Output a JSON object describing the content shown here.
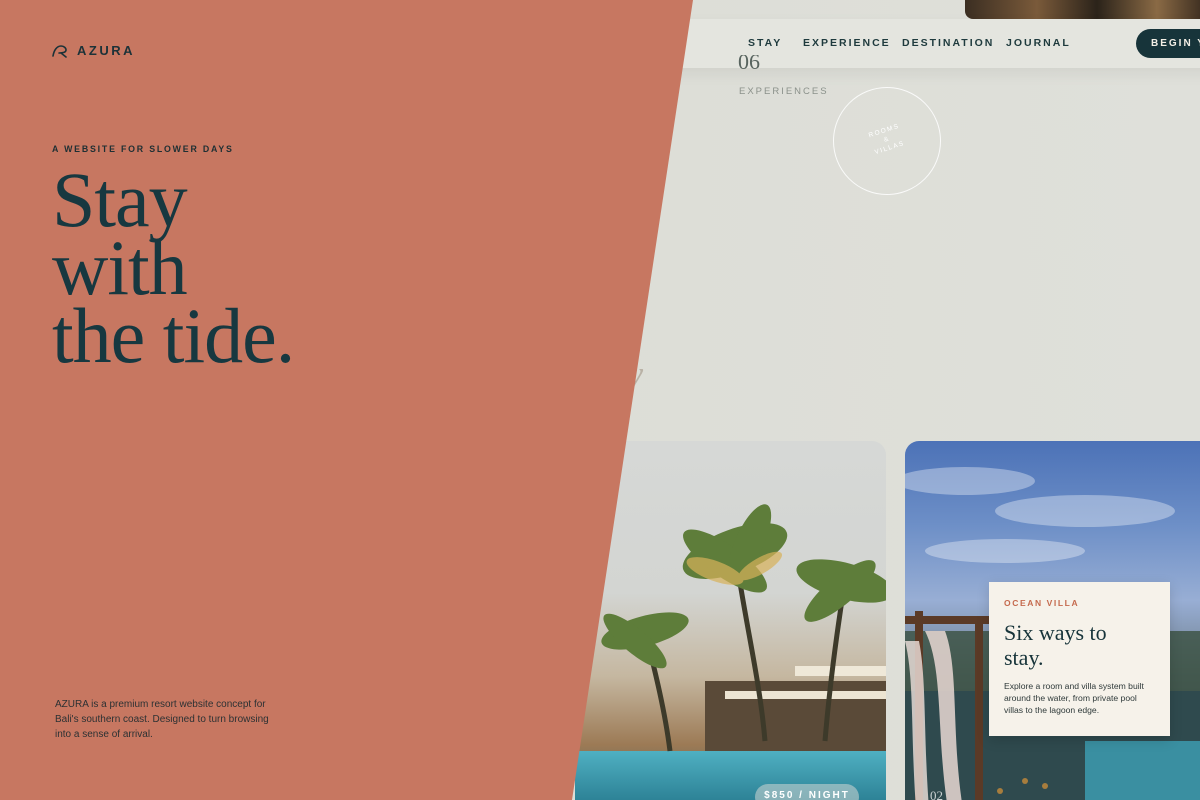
{
  "brand": {
    "name": "AZURA"
  },
  "nav": {
    "items": [
      "STAY",
      "EXPERIENCE",
      "DESTINATION",
      "JOURNAL"
    ],
    "cta_label": "BEGIN YO"
  },
  "stats": {
    "number": "06",
    "label": "EXPERIENCES"
  },
  "rooms_badge": {
    "label": "ROOMS\n&\nVILLAS"
  },
  "ghost_text": "y",
  "hero": {
    "eyebrow": "A WEBSITE FOR SLOWER DAYS",
    "headline_lines": [
      "Stay",
      "with",
      "the tide."
    ],
    "blurb": "AZURA is a premium resort website concept for Bali's southern coast. Designed to turn browsing into a sense of arrival."
  },
  "cards": {
    "price": "$850 / NIGHT",
    "index": "02"
  },
  "villa": {
    "tag": "OCEAN VILLA",
    "title": "Six ways to stay.",
    "text": "Explore a room and villa system built around the water, from private pool villas to the lagoon edge."
  },
  "colors": {
    "panel": "#c77761",
    "ink": "#173840",
    "cta_bg": "#17343a",
    "accent": "#c56a4e"
  }
}
